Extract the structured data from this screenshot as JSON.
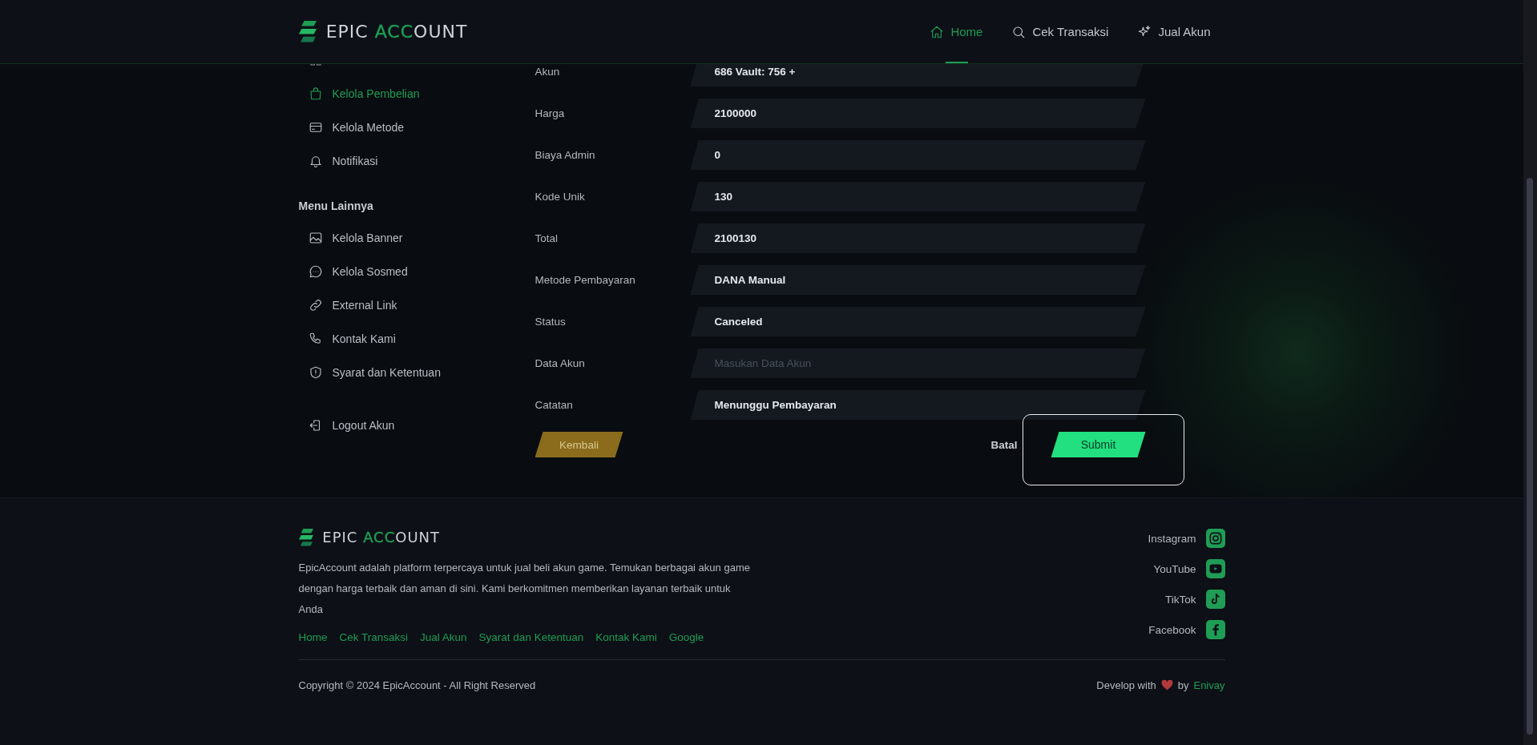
{
  "header": {
    "logo": {
      "segments": [
        {
          "text": "EPIC ",
          "highlight": false
        },
        {
          "text": "ACC",
          "highlight": true
        },
        {
          "text": "OUNT",
          "highlight": false
        }
      ]
    },
    "nav": [
      {
        "label": "Home",
        "selected": true
      },
      {
        "label": "Cek Transaksi",
        "selected": false
      },
      {
        "label": "Jual Akun",
        "selected": false
      }
    ]
  },
  "sidebar": {
    "items": [
      {
        "label": "Kelola Pembelian",
        "selected": true
      },
      {
        "label": "Kelola Metode",
        "selected": false
      },
      {
        "label": "Notifikasi",
        "selected": false
      }
    ],
    "section_title": "Menu Lainnya",
    "other_items": [
      {
        "label": "Kelola Banner",
        "selected": false
      },
      {
        "label": "Kelola Sosmed",
        "selected": false
      },
      {
        "label": "External Link",
        "selected": false
      },
      {
        "label": "Kontak Kami",
        "selected": false
      },
      {
        "label": "Syarat dan Ketentuan",
        "selected": false
      }
    ],
    "logout": {
      "label": "Logout Akun"
    }
  },
  "form": {
    "fields": [
      {
        "label": "Akun",
        "value": "686 Vault: 756 +"
      },
      {
        "label": "Harga",
        "value": "2100000"
      },
      {
        "label": "Biaya Admin",
        "value": "0"
      },
      {
        "label": "Kode Unik",
        "value": "130"
      },
      {
        "label": "Total",
        "value": "2100130"
      },
      {
        "label": "Metode Pembayaran",
        "value": "DANA Manual"
      },
      {
        "label": "Status",
        "value": "Canceled"
      },
      {
        "label": "Data Akun",
        "placeholder": "Masukan Data Akun"
      },
      {
        "label": "Catatan",
        "value": "Menunggu Pembayaran"
      }
    ],
    "back_button": "Kembali",
    "cancel_button": "Batal",
    "submit_button": "Submit"
  },
  "footer": {
    "logo": {
      "segments": [
        {
          "text": "EPIC ",
          "highlight": false
        },
        {
          "text": "ACC",
          "highlight": true
        },
        {
          "text": "OUNT",
          "highlight": false
        }
      ]
    },
    "description": "EpicAccount adalah platform terpercaya untuk jual beli akun game. Temukan berbagai akun game dengan harga terbaik dan aman di sini. Kami berkomitmen memberikan layanan terbaik untuk Anda",
    "links": [
      "Home",
      "Cek Transaksi",
      "Jual Akun",
      "Syarat dan Ketentuan",
      "Kontak Kami",
      "Google"
    ],
    "socials": [
      {
        "label": "Instagram"
      },
      {
        "label": "YouTube"
      },
      {
        "label": "TikTok"
      },
      {
        "label": "Facebook"
      }
    ],
    "copyright": "Copyright © 2024 EpicAccount - All Right Reserved",
    "credit": {
      "prefix": "Develop with",
      "middle": "by",
      "author": "Enivay"
    }
  }
}
